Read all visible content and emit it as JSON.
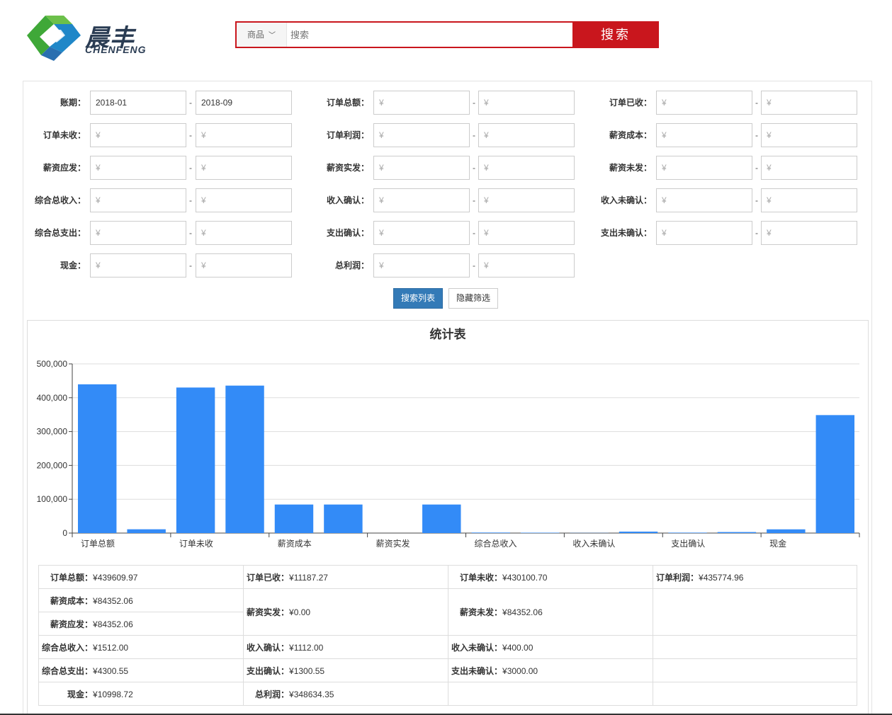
{
  "logo": {
    "cn": "晨丰",
    "en": "CHENFENG"
  },
  "search": {
    "category": "商品",
    "placeholder": "搜索",
    "button": "搜索"
  },
  "filters": [
    [
      {
        "label": "账期：",
        "from": "2018-01",
        "to": "2018-09",
        "from_ph": false,
        "to_ph": false
      },
      {
        "label": "订单总额：",
        "from": "¥",
        "to": "¥",
        "from_ph": true,
        "to_ph": true
      },
      {
        "label": "订单已收：",
        "from": "¥",
        "to": "¥",
        "from_ph": true,
        "to_ph": true
      }
    ],
    [
      {
        "label": "订单未收：",
        "from": "¥",
        "to": "¥",
        "from_ph": true,
        "to_ph": true
      },
      {
        "label": "订单利润：",
        "from": "¥",
        "to": "¥",
        "from_ph": true,
        "to_ph": true
      },
      {
        "label": "薪资成本：",
        "from": "¥",
        "to": "¥",
        "from_ph": true,
        "to_ph": true
      }
    ],
    [
      {
        "label": "薪资应发：",
        "from": "¥",
        "to": "¥",
        "from_ph": true,
        "to_ph": true
      },
      {
        "label": "薪资实发：",
        "from": "¥",
        "to": "¥",
        "from_ph": true,
        "to_ph": true
      },
      {
        "label": "薪资未发：",
        "from": "¥",
        "to": "¥",
        "from_ph": true,
        "to_ph": true
      }
    ],
    [
      {
        "label": "综合总收入：",
        "from": "¥",
        "to": "¥",
        "from_ph": true,
        "to_ph": true
      },
      {
        "label": "收入确认：",
        "from": "¥",
        "to": "¥",
        "from_ph": true,
        "to_ph": true
      },
      {
        "label": "收入未确认：",
        "from": "¥",
        "to": "¥",
        "from_ph": true,
        "to_ph": true
      }
    ],
    [
      {
        "label": "综合总支出：",
        "from": "¥",
        "to": "¥",
        "from_ph": true,
        "to_ph": true
      },
      {
        "label": "支出确认：",
        "from": "¥",
        "to": "¥",
        "from_ph": true,
        "to_ph": true
      },
      {
        "label": "支出未确认：",
        "from": "¥",
        "to": "¥",
        "from_ph": true,
        "to_ph": true
      }
    ],
    [
      {
        "label": "现金：",
        "from": "¥",
        "to": "¥",
        "from_ph": true,
        "to_ph": true
      },
      {
        "label": "总利润：",
        "from": "¥",
        "to": "¥",
        "from_ph": true,
        "to_ph": true
      }
    ]
  ],
  "range_separator": "-",
  "buttons": {
    "search_list": "搜索列表",
    "hide_filter": "隐藏筛选"
  },
  "chart_data": {
    "type": "bar",
    "title": "统计表",
    "color": "#338bf7",
    "ylim": [
      0,
      500000
    ],
    "yticks": [
      "0",
      "100,000",
      "200,000",
      "300,000",
      "400,000",
      "500,000"
    ],
    "tick_labels": [
      "订单总额",
      "订单未收",
      "薪资成本",
      "薪资实发",
      "综合总收入",
      "收入未确认",
      "支出确认",
      "现金"
    ],
    "categories": [
      "订单总额",
      "订单已收",
      "订单未收",
      "订单利润",
      "薪资成本",
      "薪资应发",
      "薪资实发",
      "薪资未发",
      "综合总收入",
      "收入确认",
      "收入未确认",
      "综合总支出",
      "支出确认",
      "支出未确认",
      "现金",
      "总利润"
    ],
    "values": [
      439609.97,
      11187.27,
      430100.7,
      435774.96,
      84352.06,
      84352.06,
      0.0,
      84352.06,
      1512.0,
      1112.0,
      400.0,
      4300.55,
      1300.55,
      3000.0,
      10998.72,
      348634.35
    ],
    "grid": true
  },
  "stats": {
    "order_total": {
      "k": "订单总额：",
      "v": "¥439609.97"
    },
    "order_received": {
      "k": "订单已收：",
      "v": "¥11187.27"
    },
    "order_unreceived": {
      "k": "订单未收：",
      "v": "¥430100.70"
    },
    "order_profit": {
      "k": "订单利润：",
      "v": "¥435774.96"
    },
    "salary_cost": {
      "k": "薪资成本：",
      "v": "¥84352.06"
    },
    "salary_due": {
      "k": "薪资应发：",
      "v": "¥84352.06"
    },
    "salary_paid": {
      "k": "薪资实发：",
      "v": "¥0.00"
    },
    "salary_unpaid": {
      "k": "薪资未发：",
      "v": "¥84352.06"
    },
    "income_total": {
      "k": "综合总收入：",
      "v": "¥1512.00"
    },
    "income_confirmed": {
      "k": "收入确认：",
      "v": "¥1112.00"
    },
    "income_unconfirmed": {
      "k": "收入未确认：",
      "v": "¥400.00"
    },
    "expense_total": {
      "k": "综合总支出：",
      "v": "¥4300.55"
    },
    "expense_confirmed": {
      "k": "支出确认：",
      "v": "¥1300.55"
    },
    "expense_unconfirmed": {
      "k": "支出未确认：",
      "v": "¥3000.00"
    },
    "cash": {
      "k": "现金：",
      "v": "¥10998.72"
    },
    "total_profit": {
      "k": "总利润：",
      "v": "¥348634.35"
    }
  }
}
